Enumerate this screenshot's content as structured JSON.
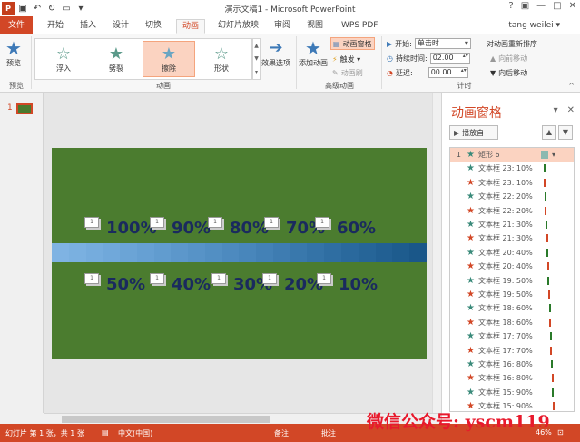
{
  "titlebar": {
    "logo": "P",
    "title": "演示文稿1 - Microsoft PowerPoint",
    "window_controls": [
      "?",
      "□",
      "—",
      "□",
      "✕"
    ]
  },
  "tabs": {
    "file": "文件",
    "items": [
      "开始",
      "插入",
      "设计",
      "切换",
      "动画",
      "幻灯片放映",
      "审阅",
      "视图",
      "WPS PDF"
    ],
    "active": "动画",
    "user": "tang weilei ▾"
  },
  "ribbon": {
    "preview": {
      "label": "预览",
      "group": "预览"
    },
    "animations": {
      "items": [
        "浮入",
        "劈裂",
        "擦除",
        "形状"
      ],
      "selected": "擦除",
      "effect_options": "效果选项",
      "group": "动画"
    },
    "advanced": {
      "add_animation": "添加动画",
      "animation_pane": "动画窗格",
      "trigger": "触发 ▾",
      "animation_painter": "动画刷",
      "group": "高级动画"
    },
    "timing": {
      "start_label": "开始:",
      "start_value": "单击时",
      "duration_label": "持续时间:",
      "duration_value": "02.00",
      "delay_label": "延迟:",
      "delay_value": "00.00",
      "reorder_title": "对动画重新排序",
      "move_earlier": "向前移动",
      "move_later": "向后移动",
      "group": "计时"
    }
  },
  "thumbnails": {
    "slide_number": "1"
  },
  "slide": {
    "top_row": [
      "100%",
      "90%",
      "80%",
      "70%",
      "60%"
    ],
    "bottom_row": [
      "50%",
      "40%",
      "30%",
      "20%",
      "10%"
    ],
    "tag_label": "1",
    "band_colors": [
      "#7fb3e3",
      "#7ab0e0",
      "#75acdd",
      "#70a8da",
      "#6ba4d6",
      "#66a0d3",
      "#619ccf",
      "#5c97cb",
      "#5793c7",
      "#528fc3",
      "#4d8abf",
      "#4886bb",
      "#4381b6",
      "#3e7cb1",
      "#3978ac",
      "#3473a7",
      "#2f6ea2",
      "#2a699d",
      "#266598",
      "#226093",
      "#1e5c8e",
      "#1a5789"
    ]
  },
  "pane": {
    "title": "动画窗格",
    "play_label": "播放自",
    "items": [
      {
        "num": "1",
        "label": "矩形 6",
        "star": "#3a8a7a",
        "bar": "#8ab9b0"
      },
      {
        "num": "",
        "label": "文本框 23: 10%",
        "star": "#3a8a7a",
        "bar": "#2a7a2a"
      },
      {
        "num": "",
        "label": "文本框 23: 10%",
        "star": "#d24726",
        "bar": "#d24726"
      },
      {
        "num": "",
        "label": "文本框 22: 20%",
        "star": "#3a8a7a",
        "bar": "#2a7a2a"
      },
      {
        "num": "",
        "label": "文本框 22: 20%",
        "star": "#d24726",
        "bar": "#d24726"
      },
      {
        "num": "",
        "label": "文本框 21: 30%",
        "star": "#3a8a7a",
        "bar": "#2a7a2a"
      },
      {
        "num": "",
        "label": "文本框 21: 30%",
        "star": "#d24726",
        "bar": "#d24726"
      },
      {
        "num": "",
        "label": "文本框 20: 40%",
        "star": "#3a8a7a",
        "bar": "#2a7a2a"
      },
      {
        "num": "",
        "label": "文本框 20: 40%",
        "star": "#d24726",
        "bar": "#d24726"
      },
      {
        "num": "",
        "label": "文本框 19: 50%",
        "star": "#3a8a7a",
        "bar": "#2a7a2a"
      },
      {
        "num": "",
        "label": "文本框 19: 50%",
        "star": "#d24726",
        "bar": "#d24726"
      },
      {
        "num": "",
        "label": "文本框 18: 60%",
        "star": "#3a8a7a",
        "bar": "#2a7a2a"
      },
      {
        "num": "",
        "label": "文本框 18: 60%",
        "star": "#d24726",
        "bar": "#d24726"
      },
      {
        "num": "",
        "label": "文本框 17: 70%",
        "star": "#3a8a7a",
        "bar": "#2a7a2a"
      },
      {
        "num": "",
        "label": "文本框 17: 70%",
        "star": "#d24726",
        "bar": "#d24726"
      },
      {
        "num": "",
        "label": "文本框 16: 80%",
        "star": "#3a8a7a",
        "bar": "#2a7a2a"
      },
      {
        "num": "",
        "label": "文本框 16: 80%",
        "star": "#d24726",
        "bar": "#d24726"
      },
      {
        "num": "",
        "label": "文本框 15: 90%",
        "star": "#3a8a7a",
        "bar": "#2a7a2a"
      },
      {
        "num": "",
        "label": "文本框 15: 90%",
        "star": "#d24726",
        "bar": "#d24726"
      }
    ]
  },
  "status": {
    "slide_info": "幻灯片 第 1 张，共 1 张",
    "language": "中文(中国)",
    "notes": "备注",
    "comments": "批注",
    "zoom": "46%"
  },
  "watermark": "微信公众号: yscm119",
  "colors": {
    "accent": "#d24726",
    "slide_bg": "#4b7c2f",
    "text_dark": "#1a2a5e"
  }
}
